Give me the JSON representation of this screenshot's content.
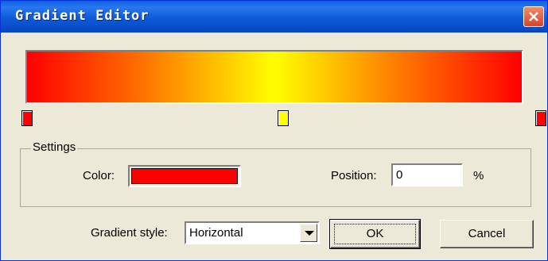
{
  "window": {
    "title": "Gradient Editor"
  },
  "gradient": {
    "stops": [
      {
        "color": "#ff0000",
        "position_pct": 0
      },
      {
        "color": "#ffff00",
        "position_pct": 50
      },
      {
        "color": "#ff0000",
        "position_pct": 100
      }
    ]
  },
  "settings": {
    "legend": "Settings",
    "color_label": "Color:",
    "color_value": "#ff0000",
    "position_label": "Position:",
    "position_value": "0",
    "position_unit": "%"
  },
  "style": {
    "label": "Gradient style:",
    "selected": "Horizontal"
  },
  "buttons": {
    "ok": "OK",
    "cancel": "Cancel"
  }
}
